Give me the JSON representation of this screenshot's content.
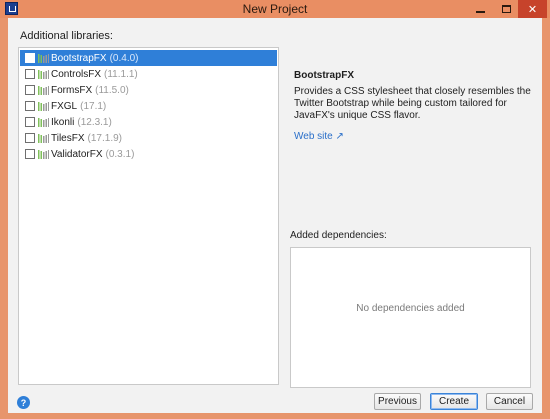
{
  "window": {
    "title": "New Project"
  },
  "titlebar": {
    "minimize_glyph": "",
    "maximize_glyph": "",
    "close_glyph": "✕"
  },
  "libraries": {
    "label": "Additional libraries:",
    "items": [
      {
        "name": "BootstrapFX",
        "version": "(0.4.0)",
        "selected": true
      },
      {
        "name": "ControlsFX",
        "version": "(11.1.1)",
        "selected": false
      },
      {
        "name": "FormsFX",
        "version": "(11.5.0)",
        "selected": false
      },
      {
        "name": "FXGL",
        "version": "(17.1)",
        "selected": false
      },
      {
        "name": "Ikonli",
        "version": "(12.3.1)",
        "selected": false
      },
      {
        "name": "TilesFX",
        "version": "(17.1.9)",
        "selected": false
      },
      {
        "name": "ValidatorFX",
        "version": "(0.3.1)",
        "selected": false
      }
    ]
  },
  "detail": {
    "title": "BootstrapFX",
    "description": "Provides a CSS stylesheet that closely resembles the Twitter Bootstrap while being custom tailored for JavaFX's unique CSS flavor.",
    "website_label": "Web site ↗"
  },
  "dependencies": {
    "label": "Added dependencies:",
    "empty_text": "No dependencies added"
  },
  "footer": {
    "help_glyph": "?",
    "previous_label": "Previous",
    "create_label": "Create",
    "cancel_label": "Cancel"
  },
  "colors": {
    "selection": "#2f7fd8",
    "titlebar": "#e98e63",
    "close": "#c7432b",
    "link": "#2a6fc9"
  }
}
